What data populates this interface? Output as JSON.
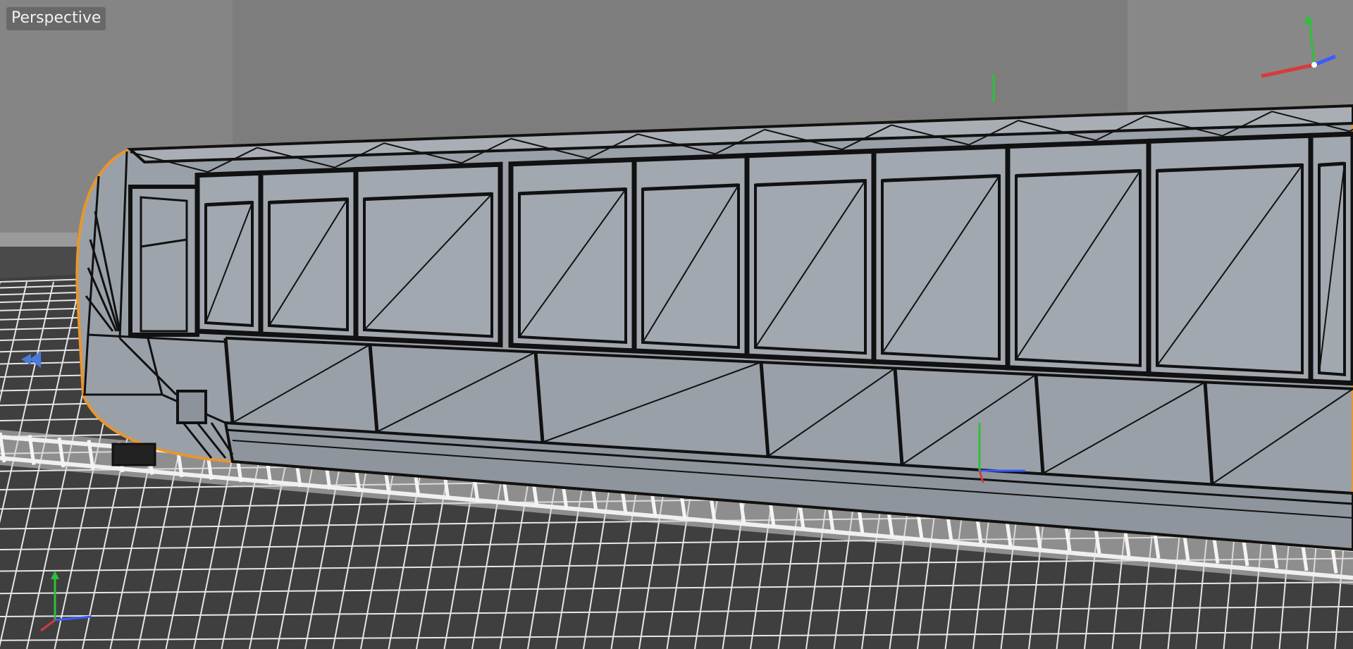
{
  "viewport": {
    "label": "Perspective",
    "view_type": "perspective",
    "display_mode": "gouraud-shading-wireframe",
    "selection_highlight": "#e8962f"
  },
  "colors": {
    "background": "#808080",
    "wall": "#8a8a8a",
    "floor": "#4e4e4e",
    "mesh_surface": "#9aa0a8",
    "wire": "#111111",
    "axis_x": "#d93a3a",
    "axis_y": "#2fbf3a",
    "axis_z": "#3a5cff"
  },
  "icons": {
    "view_axis_gizmo": "xyz-axis-icon",
    "world_axis_gizmo": "world-axis-icon",
    "object_axis": "object-axis-icon",
    "camera_marker": "camera-marker-icon"
  }
}
